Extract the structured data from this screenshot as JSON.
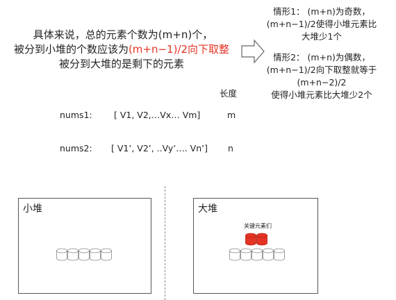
{
  "intro": {
    "line1": "具体来说，总的元素个数为(m+n)个，",
    "line2_prefix": "被分到小堆的个数应该为",
    "line2_highlight": "(m+n−1)/2向下取整",
    "line3": "被分到大堆的是剩下的元素"
  },
  "cases": {
    "case1": [
      "情形1：  (m+n)为奇数，",
      "(m+n−1)/2使得小堆元素比",
      "大堆少1个"
    ],
    "case2": [
      "情形2：  (m+n)为偶数，",
      "(m+n−1)/2向下取整就等于",
      "(m+n−2)/2",
      "使得小堆元素比大堆少2个"
    ]
  },
  "length_header": "长度",
  "arrays": [
    {
      "name": "nums1:",
      "content": "[ V1, V2,…Vx… Vm]",
      "length": "m"
    },
    {
      "name": "nums2:",
      "content": "[ V1’, V2’, ..Vy’…. Vn’]",
      "length": "n"
    }
  ],
  "small_heap": {
    "title": "小堆",
    "element_count": 5
  },
  "big_heap": {
    "title": "大堆",
    "key_label": "关键元素们",
    "key_count": 2,
    "element_count": 5
  },
  "colors": {
    "highlight": "#e53324",
    "key_fill": "#e53324",
    "cylinder_stroke": "#888888"
  }
}
